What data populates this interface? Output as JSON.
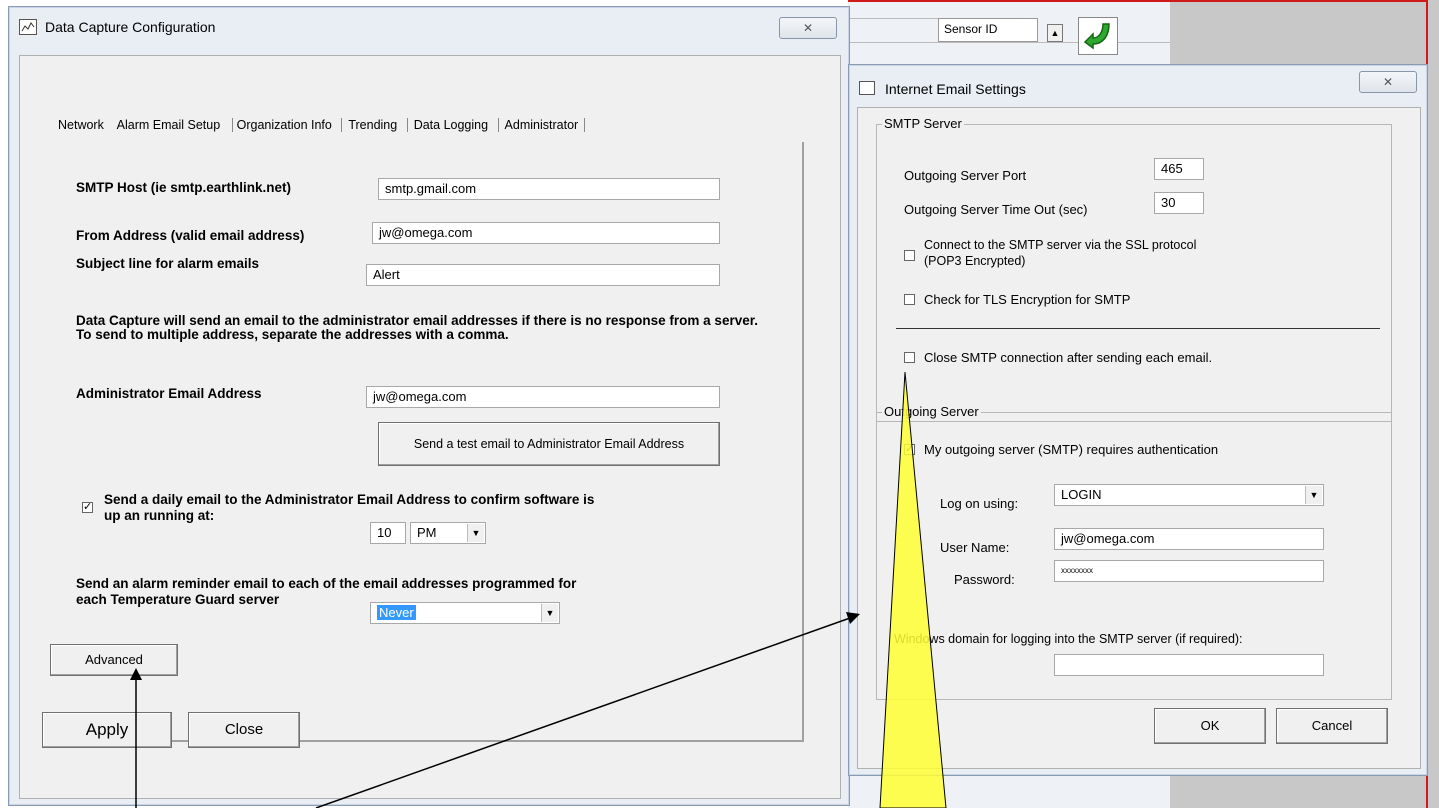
{
  "bg_app": {
    "sensor_id_label": "Sensor ID",
    "scroll_up": "▲"
  },
  "main_window": {
    "title": "Data Capture Configuration",
    "close_label": "✕",
    "tabs": [
      "Network",
      "Alarm Email Setup",
      "Organization Info",
      "Trending",
      "Data Logging",
      "Administrator"
    ],
    "smtp_host_label": "SMTP Host (ie smtp.earthlink.net)",
    "smtp_host_value": "smtp.gmail.com",
    "from_label": "From Address (valid email address)",
    "from_value": "jw@omega.com",
    "subject_label": "Subject line for alarm emails",
    "subject_value": "Alert",
    "info_text": "Data Capture will send an email to the administrator email addresses if there is no response from a server.  To send to multiple address, separate the addresses with a comma.",
    "admin_label": "Administrator Email Address",
    "admin_value": "jw@omega.com",
    "test_button": "Send a test email to Administrator Email Address",
    "daily_label_1": "Send a daily email to the Administrator Email Address to confirm software is",
    "daily_label_2": "up an running at:",
    "daily_checked": "✓",
    "hour_value": "10",
    "ampm_value": "PM",
    "reminder_label_1": "Send an alarm reminder email to each of the email addresses programmed for",
    "reminder_label_2": "each Temperature Guard server",
    "reminder_value": "Never",
    "advanced_button": "Advanced",
    "apply_button": "Apply",
    "close_button": "Close"
  },
  "email_window": {
    "title": "Internet Email Settings",
    "close_label": "✕",
    "smtp_group": "SMTP Server",
    "port_label": "Outgoing Server Port",
    "port_value": "465",
    "timeout_label": "Outgoing Server Time Out (sec)",
    "timeout_value": "30",
    "ssl_label_1": "Connect to the SMTP server via the SSL protocol",
    "ssl_label_2": "(POP3 Encrypted)",
    "tls_label": "Check for TLS Encryption for SMTP",
    "close_conn_label": "Close SMTP connection after sending each email.",
    "outgoing_group": "Outgoing Server",
    "auth_label": "My outgoing server (SMTP) requires authentication",
    "auth_checked": "✓",
    "logon_label": "Log on using:",
    "logon_value": "LOGIN",
    "username_label": "User Name:",
    "username_value": "jw@omega.com",
    "password_label": "Password:",
    "password_value": "xxxxxxxx",
    "domain_label": "Windows domain for logging into the SMTP server (if required):",
    "domain_value": "",
    "ok_button": "OK",
    "cancel_button": "Cancel"
  },
  "colors": {
    "annotation_yellow": "#ffff33",
    "selection_blue": "#3399ff"
  }
}
